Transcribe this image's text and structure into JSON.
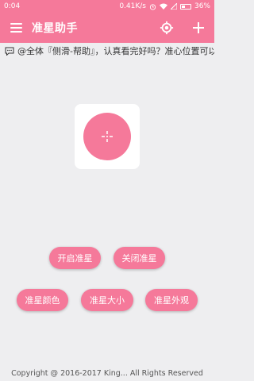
{
  "status_bar": {
    "time": "0:04",
    "speed": "0.41K/s",
    "battery": "36%"
  },
  "app_bar": {
    "title": "准星助手",
    "menu_icon": "hamburger-menu-icon",
    "locate_icon": "crosshair-target-icon",
    "add_icon": "plus-icon",
    "color": "#f5799a"
  },
  "notice": {
    "icon": "chat-bubble-icon",
    "text": "@全体『侧滑-帮助』，认真看完好吗？准心位置可以"
  },
  "preview": {
    "icon": "crosshair-icon"
  },
  "buttons": {
    "open": "开启准星",
    "close": "关闭准星",
    "color": "准星颜色",
    "size": "准星大小",
    "style": "准星外观"
  },
  "footer": {
    "copyright": "Copyright @ 2016-2017 King... All Rights Reserved"
  }
}
